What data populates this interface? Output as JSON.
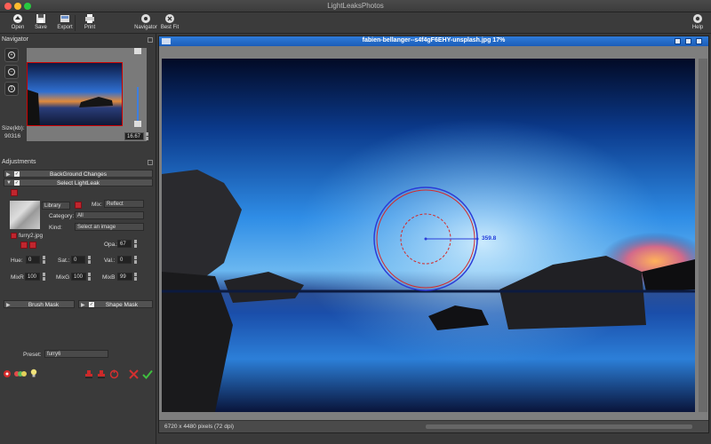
{
  "app": {
    "title": "LightLeaksPhotos"
  },
  "toolbar": {
    "open": "Open",
    "save": "Save",
    "export": "Export",
    "print": "Print",
    "navigator": "Navigator",
    "best_fit": "Best Fit",
    "help": "Help"
  },
  "navigator": {
    "title": "Navigator",
    "size_label": "Size(kb):",
    "size_value": "90316",
    "zoom_value": "16.67"
  },
  "adjustments": {
    "title": "Adjustments",
    "background_changes": "BackGround Changes",
    "select_lightleak": "Select LightLeak",
    "library": "Library",
    "mix_label": "Mix:",
    "mix_value": "Reflect",
    "category_label": "Category:",
    "category_value": "All",
    "kind_label": "Kind:",
    "kind_value": "Select an image",
    "file_name": "furry2.jpg",
    "opa_label": "Opa.:",
    "opa_value": "67",
    "hue_label": "Hue:",
    "hue_value": "0",
    "sat_label": "Sat.:",
    "sat_value": "0",
    "val_label": "Val.:",
    "val_value": "0",
    "mixr_label": "MixR",
    "mixr_value": "100",
    "mixg_label": "MixG",
    "mixg_value": "100",
    "mixb_label": "MixB",
    "mixb_value": "99",
    "brush_mask": "Brush Mask",
    "shape_mask": "Shape Mask",
    "preset_label": "Preset:",
    "preset_value": "furry6"
  },
  "image_window": {
    "title": "fabien-bellanger--s4f4gF6EHY-unsplash.jpg 17%",
    "radius_label": "359.8",
    "status": "6720 x 4480 pixels (72 dpi)"
  },
  "colors": {
    "accent": "#1f63c2",
    "danger": "#c0262e",
    "ok": "#3fbf3f"
  }
}
